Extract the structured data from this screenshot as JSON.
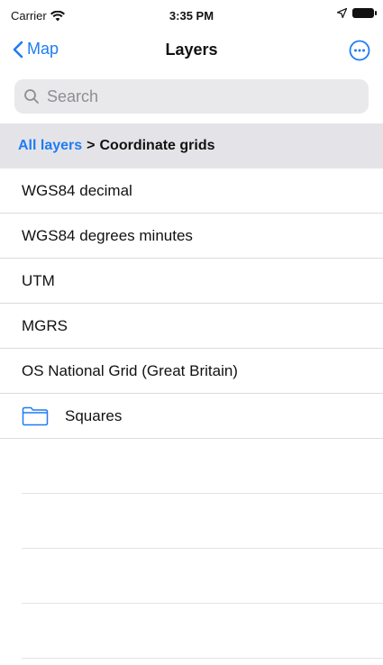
{
  "status_bar": {
    "carrier": "Carrier",
    "time": "3:35 PM"
  },
  "nav": {
    "back_label": "Map",
    "title": "Layers",
    "accent_color": "#1f7cf4"
  },
  "search": {
    "placeholder": "Search",
    "value": ""
  },
  "breadcrumb": {
    "root": "All layers",
    "separator": ">",
    "current": "Coordinate grids"
  },
  "layers": [
    {
      "label": "WGS84 decimal",
      "icon": null
    },
    {
      "label": "WGS84 degrees minutes",
      "icon": null
    },
    {
      "label": "UTM",
      "icon": null
    },
    {
      "label": "MGRS",
      "icon": null
    },
    {
      "label": "OS National Grid (Great Britain)",
      "icon": null
    },
    {
      "label": "Squares",
      "icon": "folder-icon"
    }
  ]
}
